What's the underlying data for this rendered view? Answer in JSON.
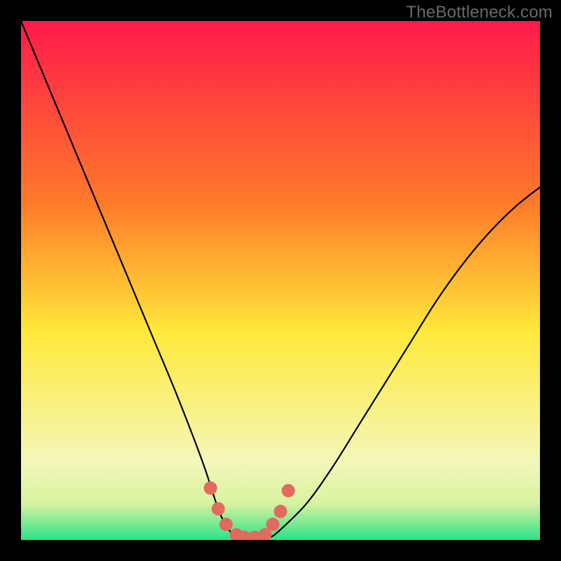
{
  "watermark": "TheBottleneck.com",
  "colors": {
    "bg_black": "#000000",
    "grad_top": "#ff1a4b",
    "grad_mid_orange": "#ff8a2a",
    "grad_yellow": "#ffe93a",
    "grad_pale": "#f8f8c8",
    "grad_green": "#2ce28a",
    "curve": "#000000",
    "marker": "#e26a5f"
  },
  "chart_data": {
    "type": "line",
    "title": "",
    "xlabel": "",
    "ylabel": "",
    "xlim": [
      0,
      1
    ],
    "ylim": [
      0,
      1
    ],
    "series": [
      {
        "name": "bottleneck-curve",
        "x": [
          0.0,
          0.05,
          0.1,
          0.15,
          0.2,
          0.25,
          0.3,
          0.35,
          0.38,
          0.4,
          0.42,
          0.44,
          0.46,
          0.48,
          0.5,
          0.55,
          0.6,
          0.65,
          0.7,
          0.75,
          0.8,
          0.85,
          0.9,
          0.95,
          1.0
        ],
        "y": [
          1.0,
          0.88,
          0.76,
          0.64,
          0.52,
          0.4,
          0.28,
          0.15,
          0.06,
          0.02,
          0.005,
          0.0,
          0.0,
          0.005,
          0.02,
          0.07,
          0.14,
          0.22,
          0.3,
          0.38,
          0.46,
          0.53,
          0.59,
          0.64,
          0.68
        ]
      }
    ],
    "markers": {
      "name": "highlight-dots",
      "x": [
        0.365,
        0.38,
        0.395,
        0.415,
        0.43,
        0.45,
        0.47,
        0.485,
        0.5,
        0.515
      ],
      "y": [
        0.1,
        0.06,
        0.03,
        0.01,
        0.005,
        0.005,
        0.01,
        0.03,
        0.055,
        0.095
      ]
    },
    "gradient_stops": [
      {
        "offset": 0.0,
        "color": "#ff1a4b"
      },
      {
        "offset": 0.35,
        "color": "#ff7a2a"
      },
      {
        "offset": 0.6,
        "color": "#ffe93a"
      },
      {
        "offset": 0.85,
        "color": "#f4f7ba"
      },
      {
        "offset": 0.93,
        "color": "#d7f3a0"
      },
      {
        "offset": 1.0,
        "color": "#2ce28a"
      }
    ]
  }
}
